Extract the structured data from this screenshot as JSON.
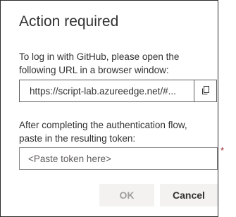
{
  "dialog": {
    "title": "Action required",
    "instructions": "To log in with GitHub, please open the following URL in a browser window:",
    "url": {
      "value": "https://script-lab.azureedge.net/#..."
    },
    "copy_icon": "copy-icon",
    "after_text": "After completing the authentication flow, paste in the resulting token:",
    "token": {
      "placeholder": "<Paste token here>",
      "value": "",
      "required_marker": "*"
    },
    "buttons": {
      "ok_label": "OK",
      "ok_enabled": false,
      "cancel_label": "Cancel"
    }
  },
  "colors": {
    "text": "#323130",
    "border": "#605e5c",
    "button_bg": "#f3f2f1",
    "disabled_text": "#a19f9d",
    "required": "#a4262c"
  }
}
